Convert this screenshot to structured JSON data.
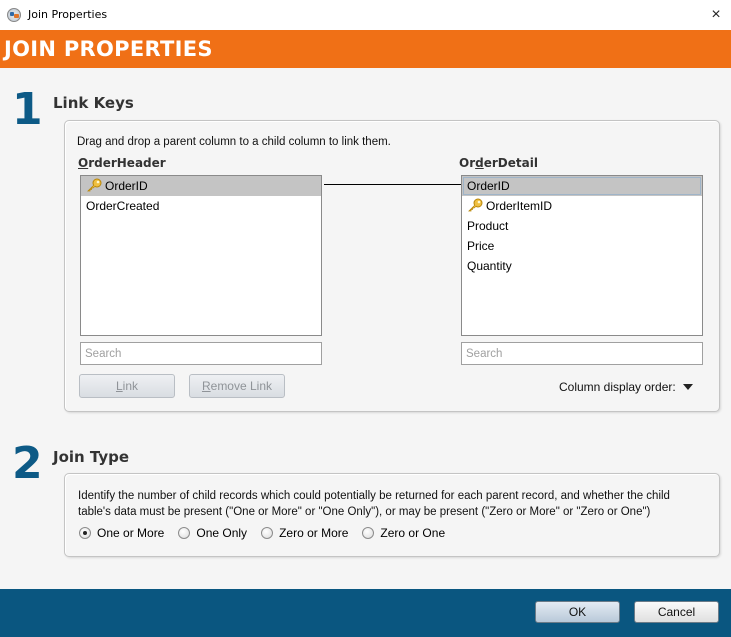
{
  "window": {
    "title": "Join Properties",
    "close_label": "×"
  },
  "banner": {
    "title": "JOIN PROPERTIES"
  },
  "link_keys": {
    "step_number": "1",
    "heading": "Link Keys",
    "hint": "Drag and drop a parent column to a child column to link them.",
    "parent": {
      "label_mnemonic": "O",
      "label_rest": "rderHeader",
      "columns": [
        {
          "name": "OrderID",
          "is_key": true,
          "selected": true
        },
        {
          "name": "OrderCreated",
          "is_key": false,
          "selected": false
        }
      ],
      "search_placeholder": "Search"
    },
    "child": {
      "label_pre": "Or",
      "label_mnemonic": "d",
      "label_rest": "erDetail",
      "columns": [
        {
          "name": "OrderID",
          "is_key": false,
          "selected": true
        },
        {
          "name": "OrderItemID",
          "is_key": true,
          "selected": false
        },
        {
          "name": "Product",
          "is_key": false,
          "selected": false
        },
        {
          "name": "Price",
          "is_key": false,
          "selected": false
        },
        {
          "name": "Quantity",
          "is_key": false,
          "selected": false
        }
      ],
      "search_placeholder": "Search"
    },
    "link": {
      "parent_column": "OrderID",
      "child_column": "OrderID"
    },
    "buttons": {
      "link_mnemonic": "L",
      "link_rest": "ink",
      "remove_mnemonic": "R",
      "remove_rest": "emove Link"
    },
    "column_display_order_label": "Column display order:"
  },
  "join_type": {
    "step_number": "2",
    "heading": "Join Type",
    "description_line1": "Identify the number of child records which could potentially be returned for each parent record, and whether the child",
    "description_line2": "table's data must be present (\"One or More\" or \"One Only\"), or may be present (\"Zero or More\" or \"Zero or One\")",
    "options": [
      {
        "label": "One or More",
        "checked": true
      },
      {
        "label": "One Only",
        "checked": false
      },
      {
        "label": "Zero or More",
        "checked": false
      },
      {
        "label": "Zero or One",
        "checked": false
      }
    ]
  },
  "footer": {
    "ok_label": "OK",
    "cancel_label": "Cancel"
  },
  "colors": {
    "banner": "#f07016",
    "step_number": "#0d5a86",
    "footer": "#0a5680"
  }
}
